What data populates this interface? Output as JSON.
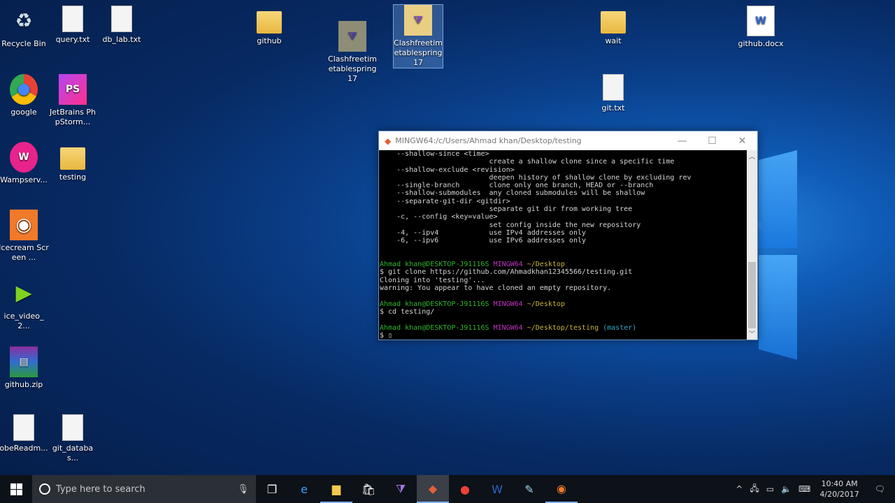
{
  "desktop_icons": [
    {
      "label": "Recycle Bin",
      "glyph": "♻",
      "kind": "bin"
    },
    {
      "label": "query.txt",
      "glyph": "",
      "kind": "doc"
    },
    {
      "label": "db_lab.txt",
      "glyph": "",
      "kind": "doc"
    },
    {
      "label": "github",
      "glyph": "",
      "kind": "folder"
    },
    {
      "label": "Clashfreetimetablespring17",
      "glyph": "⧩",
      "kind": "vs-ghost"
    },
    {
      "label": "Clashfreetimetablespring17",
      "glyph": "⧩",
      "kind": "vs-selected"
    },
    {
      "label": "wait",
      "glyph": "",
      "kind": "folder"
    },
    {
      "label": "github.docx",
      "glyph": "W",
      "kind": "word"
    },
    {
      "label": "google",
      "glyph": "●",
      "kind": "chrome"
    },
    {
      "label": "JetBrains PhpStorm...",
      "glyph": "PS",
      "kind": "phpstorm"
    },
    {
      "label": "git.txt",
      "glyph": "",
      "kind": "doc"
    },
    {
      "label": "Wampserv...",
      "glyph": "W",
      "kind": "wamp"
    },
    {
      "label": "testing",
      "glyph": "",
      "kind": "folder"
    },
    {
      "label": "Icecream Screen ...",
      "glyph": "◉",
      "kind": "icecream"
    },
    {
      "label": "ice_video_2...",
      "glyph": "▶",
      "kind": "video"
    },
    {
      "label": "github.zip",
      "glyph": "▤",
      "kind": "zip"
    },
    {
      "label": "obeReadm...",
      "glyph": "",
      "kind": "doc"
    },
    {
      "label": "git_databas...",
      "glyph": "",
      "kind": "doc"
    }
  ],
  "terminal": {
    "title": "MINGW64:/c/Users/Ahmad khan/Desktop/testing",
    "lines": [
      [
        {
          "t": "    --shallow-since <time>"
        }
      ],
      [
        {
          "t": "                          create a shallow clone since a specific time"
        }
      ],
      [
        {
          "t": "    --shallow-exclude <revision>"
        }
      ],
      [
        {
          "t": "                          deepen history of shallow clone by excluding rev"
        }
      ],
      [
        {
          "t": "    --single-branch       clone only one branch, HEAD or --branch"
        }
      ],
      [
        {
          "t": "    --shallow-submodules  any cloned submodules will be shallow"
        }
      ],
      [
        {
          "t": "    --separate-git-dir <gitdir>"
        }
      ],
      [
        {
          "t": "                          separate git dir from working tree"
        }
      ],
      [
        {
          "t": "    -c, --config <key=value>"
        }
      ],
      [
        {
          "t": "                          set config inside the new repository"
        }
      ],
      [
        {
          "t": "    -4, --ipv4            use IPv4 addresses only"
        }
      ],
      [
        {
          "t": "    -6, --ipv6            use IPv6 addresses only"
        }
      ],
      [
        {
          "t": ""
        }
      ],
      [
        {
          "t": ""
        }
      ],
      [
        {
          "t": "Ahmad khan@DESKTOP-J91116S ",
          "c": "g1"
        },
        {
          "t": "MINGW64 ",
          "c": "m1"
        },
        {
          "t": "~/Desktop",
          "c": "y1"
        }
      ],
      [
        {
          "t": "$ git clone https://github.com/Ahmadkhan12345566/testing.git"
        }
      ],
      [
        {
          "t": "Cloning into 'testing'..."
        }
      ],
      [
        {
          "t": "warning: You appear to have cloned an empty repository."
        }
      ],
      [
        {
          "t": ""
        }
      ],
      [
        {
          "t": "Ahmad khan@DESKTOP-J91116S ",
          "c": "g1"
        },
        {
          "t": "MINGW64 ",
          "c": "m1"
        },
        {
          "t": "~/Desktop",
          "c": "y1"
        }
      ],
      [
        {
          "t": "$ cd testing/"
        }
      ],
      [
        {
          "t": ""
        }
      ],
      [
        {
          "t": "Ahmad khan@DESKTOP-J91116S ",
          "c": "g1"
        },
        {
          "t": "MINGW64 ",
          "c": "m1"
        },
        {
          "t": "~/Desktop/testing ",
          "c": "y1"
        },
        {
          "t": "(master)",
          "c": "c1"
        }
      ],
      [
        {
          "t": "$ ▯"
        }
      ]
    ]
  },
  "taskbar": {
    "search_placeholder": "Type here to search",
    "apps": [
      {
        "name": "task-view",
        "glyph": "❐",
        "color": "#ffffff"
      },
      {
        "name": "edge",
        "glyph": "e",
        "color": "#3aa0ff"
      },
      {
        "name": "file-explorer",
        "glyph": "▆",
        "color": "#f2c94c"
      },
      {
        "name": "store",
        "glyph": "🛍",
        "color": "#ffffff"
      },
      {
        "name": "visual-studio",
        "glyph": "⧩",
        "color": "#a277e0"
      },
      {
        "name": "git-gui",
        "glyph": "◆",
        "color": "#e0603a"
      },
      {
        "name": "chrome",
        "glyph": "●",
        "color": "#e94235"
      },
      {
        "name": "word",
        "glyph": "W",
        "color": "#2b65c8"
      },
      {
        "name": "notepad",
        "glyph": "✎",
        "color": "#9fd8f0"
      },
      {
        "name": "icecream-recorder",
        "glyph": "◉",
        "color": "#f07a2a"
      }
    ],
    "time": "10:40 AM",
    "date": "4/20/2017"
  }
}
